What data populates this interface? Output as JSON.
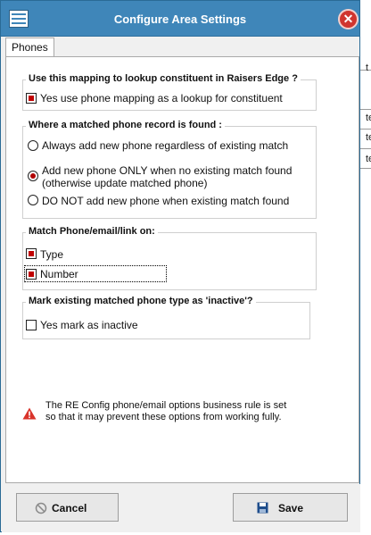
{
  "window": {
    "title": "Configure Area Settings"
  },
  "tabs": [
    {
      "label": "Phones"
    }
  ],
  "lookup_group": {
    "title": "Use this mapping to lookup constituent in Raisers Edge ?",
    "option": {
      "label": "Yes use phone mapping as a lookup for constituent",
      "checked": true
    }
  },
  "match_found_group": {
    "title": "Where a matched phone record is found :",
    "options": [
      {
        "label": "Always add new phone regardless of existing match",
        "selected": false
      },
      {
        "label_line1": "Add new phone ONLY when no existing match found",
        "label_line2": "(otherwise update matched phone)",
        "selected": true
      },
      {
        "label": "DO NOT add new phone when existing match found",
        "selected": false
      }
    ]
  },
  "match_on_group": {
    "title": "Match Phone/email/link on:",
    "options": [
      {
        "label": "Type",
        "checked": true
      },
      {
        "label": "Number",
        "checked": true
      }
    ]
  },
  "inactive_group": {
    "title": "Mark existing matched phone type as 'inactive'?",
    "option": {
      "label": "Yes mark as inactive",
      "checked": false
    }
  },
  "warning": {
    "line1": "The RE Config phone/email options business rule is set",
    "line2": "so that it may prevent these options from working fully.",
    "icon": "warning-triangle-icon"
  },
  "buttons": {
    "cancel": {
      "label": "Cancel",
      "icon": "cancel-icon"
    },
    "save": {
      "label": "Save",
      "icon": "floppy-disk-icon"
    }
  },
  "background_window": {
    "chars": [
      "t",
      "te",
      "te",
      "te"
    ]
  },
  "colors": {
    "titlebar": "#3f86b9",
    "close": "#d0352f",
    "selected": "#b00000"
  }
}
